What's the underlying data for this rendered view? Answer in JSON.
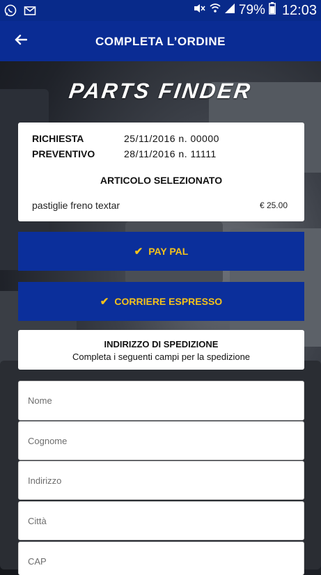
{
  "status_bar": {
    "battery_percent": "79%",
    "time": "12:03",
    "icons": [
      "whatsapp-icon",
      "mail-icon",
      "mute-icon",
      "wifi-icon",
      "signal-icon",
      "battery-icon"
    ]
  },
  "app_bar": {
    "title": "COMPLETA L’ORDINE",
    "back_icon": "arrow-left-icon"
  },
  "brand": "PARTS FINDER",
  "order": {
    "richiesta_label": "RICHIESTA",
    "richiesta_value": "25/11/2016 n. 00000",
    "preventivo_label": "PREVENTIVO",
    "preventivo_value": "28/11/2016 n. 11111",
    "selected_title": "ARTICOLO SELEZIONATO",
    "item_name": "pastiglie freno textar",
    "item_price": "€ 25.00"
  },
  "payment_button": {
    "label": "PAY PAL",
    "icon": "checkmark-icon"
  },
  "shipping_button": {
    "label": "CORRIERE ESPRESSO",
    "icon": "checkmark-icon"
  },
  "shipping_address": {
    "title": "INDIRIZZO DI SPEDIZIONE",
    "subtitle": "Completa i seguenti campi per la spedizione"
  },
  "form": {
    "nome_placeholder": "Nome",
    "cognome_placeholder": "Cognome",
    "indirizzo_placeholder": "Indirizzo",
    "citta_placeholder": "Città",
    "cap_placeholder": "CAP"
  },
  "colors": {
    "primary_blue": "#0a2c94",
    "accent_yellow": "#f4c21b"
  }
}
